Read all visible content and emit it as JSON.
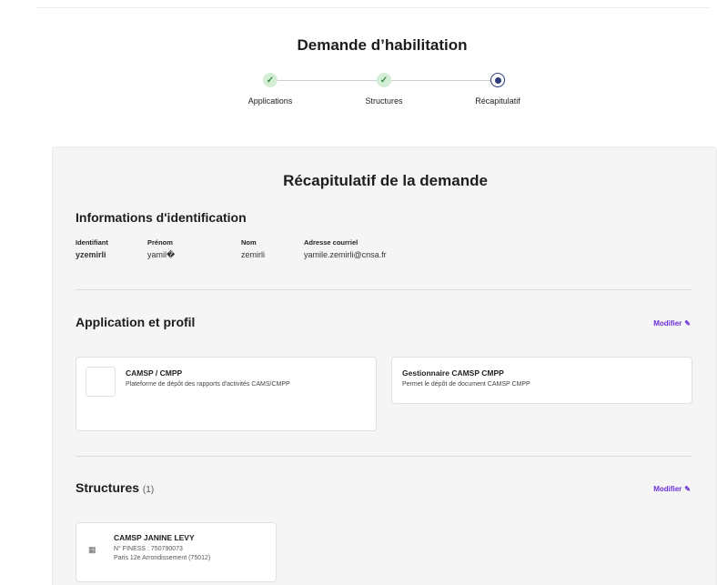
{
  "page": {
    "title": "Demande d’habilitation"
  },
  "stepper": {
    "steps": [
      {
        "label": "Applications",
        "status": "done"
      },
      {
        "label": "Structures",
        "status": "done"
      },
      {
        "label": "Récapitulatif",
        "status": "current"
      }
    ]
  },
  "recap": {
    "title": "Récapitulatif de la demande",
    "identification": {
      "title": "Informations d'identification",
      "fields": [
        {
          "label": "Identifiant",
          "value": "yzemirli"
        },
        {
          "label": "Prénom",
          "value": "yamil�"
        },
        {
          "label": "Nom",
          "value": "zemirli"
        },
        {
          "label": "Adresse courriel",
          "value": "yamile.zemirli@cnsa.fr"
        }
      ]
    },
    "application": {
      "title": "Application et profil",
      "modify_label": "Modifier",
      "app_card": {
        "title": "CAMSP / CMPP",
        "description": "Plateforme de dépôt des rapports d'activités CAMS/CMPP"
      },
      "profile_card": {
        "title": "Gestionnaire CAMSP CMPP",
        "description": "Permet le dépôt de document CAMSP CMPP"
      }
    },
    "structures": {
      "title": "Structures",
      "count": "(1)",
      "modify_label": "Modifier",
      "items": [
        {
          "name": "CAMSP JANINE LEVY",
          "finess": "N° FINESS : 750790073",
          "address": "Paris 12e Arrondissement (75012)"
        }
      ]
    }
  },
  "colors": {
    "accent": "#6b2fd6",
    "step_done_bg": "#d3eed5",
    "step_done_check": "#3a8a45",
    "step_current": "#2f3a7a",
    "panel_bg": "#f5f5f5"
  }
}
